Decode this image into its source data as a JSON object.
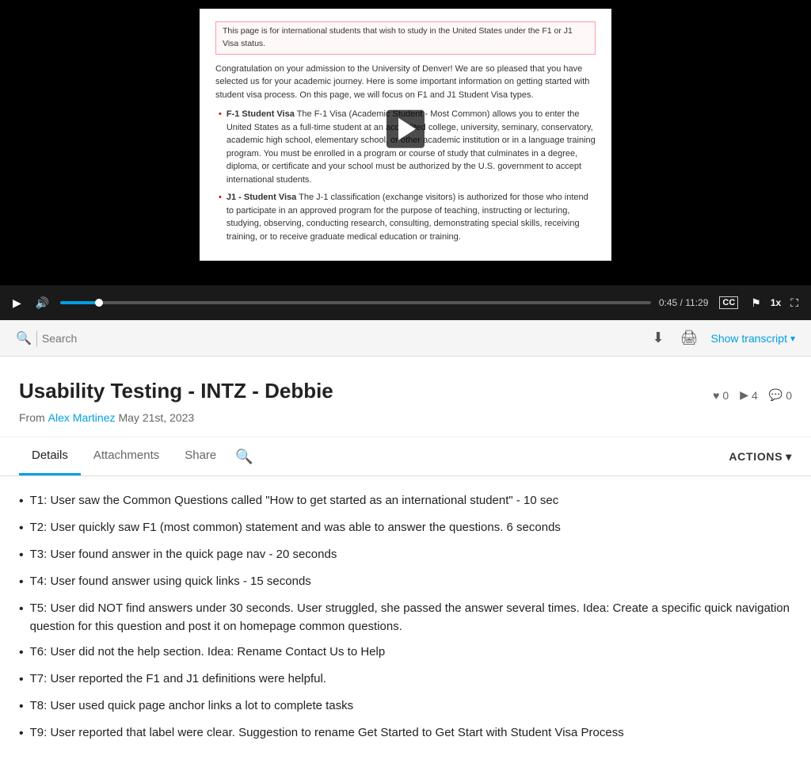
{
  "video": {
    "content": {
      "highlight_text": "This page is for international students that wish to study in the United States under the F1 or J1 Visa status.",
      "intro": "Congratulation on your admission to the University of Denver! We are so pleased that you have selected us for your academic journey. Here is some important information on getting started with student visa process. On this page, we will focus on F1 and J1 Student Visa types.",
      "bullet1_title": "F-1 Student Visa",
      "bullet1_body": "The F-1 Visa (Academic Student - Most Common) allows you to enter the United States as a full-time student at an accredited college, university, seminary, conservatory, academic high school, elementary school, or other academic institution or in a language training program. You must be enrolled in a program or course of study that culminates in a degree, diploma, or certificate and your school must be authorized by the U.S. government to accept international students.",
      "bullet2_title": "J1 - Student Visa",
      "bullet2_body": "The J-1 classification (exchange visitors) is authorized for those who intend to participate in an approved program for the purpose of teaching, instructing or lecturing, studying, observing, conducting research, consulting, demonstrating special skills, receiving training, or to receive graduate medical education or training."
    },
    "controls": {
      "current_time": "0:45",
      "total_time": "11:29",
      "speed": "1x"
    }
  },
  "toolbar": {
    "search_placeholder": "Search",
    "show_transcript_label": "Show transcript"
  },
  "title_section": {
    "title": "Usability Testing - INTZ - Debbie",
    "from_label": "From",
    "author": "Alex Martinez",
    "date": "May 21st, 2023",
    "likes_count": "0",
    "plays_count": "4",
    "comments_count": "0"
  },
  "tabs": {
    "items": [
      {
        "label": "Details",
        "active": true
      },
      {
        "label": "Attachments",
        "active": false
      },
      {
        "label": "Share",
        "active": false
      }
    ],
    "actions_label": "ACTIONS"
  },
  "details": {
    "list_items": [
      "T1: User saw the Common Questions called \"How to get started as an international student\" - 10 sec",
      "T2: User quickly saw F1 (most common) statement and was able to answer the questions. 6 seconds",
      "T3:  User found answer in the quick page nav - 20 seconds",
      "T4: User found answer using quick links - 15 seconds",
      "T5: User did NOT find answers under 30 seconds. User struggled, she passed the answer several times. Idea: Create a specific quick navigation question for this question and post it on homepage common questions.",
      "T6: User did not the help section. Idea: Rename Contact Us to Help",
      "T7: User reported the F1 and J1 definitions were helpful.",
      "T8: User used quick page anchor links a lot to complete tasks",
      "T9: User reported that label were clear. Suggestion to rename Get Started to Get Start with Student Visa Process"
    ]
  },
  "icons": {
    "play": "▶",
    "volume": "🔊",
    "cc": "CC",
    "flag": "⚑",
    "fullscreen": "⛶",
    "download": "⬇",
    "print": "🖨",
    "search": "🔍",
    "heart": "♥",
    "play_small": "▶",
    "comment": "💬",
    "chevron_down": "▾"
  }
}
